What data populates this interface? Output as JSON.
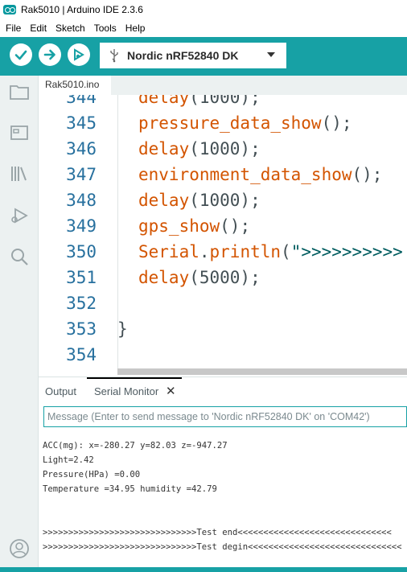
{
  "window": {
    "title": "Rak5010 | Arduino IDE 2.3.6"
  },
  "menu": [
    "File",
    "Edit",
    "Sketch",
    "Tools",
    "Help"
  ],
  "toolbar": {
    "verify_icon": "check-icon",
    "upload_icon": "arrow-right-icon",
    "debug_icon": "debug-icon",
    "board": "Nordic nRF52840 DK"
  },
  "sidebar": [
    "folder-icon",
    "boards-icon",
    "library-icon",
    "debug-icon",
    "search-icon",
    "account-icon"
  ],
  "tabs": [
    {
      "label": "Rak5010.ino"
    }
  ],
  "editor": {
    "lines": [
      {
        "n": "344",
        "code": [
          {
            "t": "delay",
            "c": "k"
          },
          {
            "t": "(1000);",
            "c": "p"
          }
        ]
      },
      {
        "n": "345",
        "code": [
          {
            "t": "pressure_data_show",
            "c": "k"
          },
          {
            "t": "();",
            "c": "p"
          }
        ]
      },
      {
        "n": "346",
        "code": [
          {
            "t": "delay",
            "c": "k"
          },
          {
            "t": "(1000);",
            "c": "p"
          }
        ]
      },
      {
        "n": "347",
        "code": [
          {
            "t": "environment_data_show",
            "c": "k"
          },
          {
            "t": "();",
            "c": "p"
          }
        ]
      },
      {
        "n": "348",
        "code": [
          {
            "t": "delay",
            "c": "k"
          },
          {
            "t": "(1000);",
            "c": "p"
          }
        ]
      },
      {
        "n": "349",
        "code": [
          {
            "t": "gps_show",
            "c": "k"
          },
          {
            "t": "();",
            "c": "p"
          }
        ]
      },
      {
        "n": "350",
        "code": [
          {
            "t": "Serial",
            "c": "k"
          },
          {
            "t": ".",
            "c": "p"
          },
          {
            "t": "println",
            "c": "k"
          },
          {
            "t": "(",
            "c": "p"
          },
          {
            "t": "\">>>>>>>>>>",
            "c": "s"
          }
        ]
      },
      {
        "n": "351",
        "code": [
          {
            "t": "delay",
            "c": "k"
          },
          {
            "t": "(5000);",
            "c": "p"
          }
        ]
      },
      {
        "n": "352",
        "code": []
      },
      {
        "n": "353",
        "code": [
          {
            "t": "}",
            "c": "p"
          }
        ]
      },
      {
        "n": "354",
        "code": []
      }
    ]
  },
  "panel": {
    "tabs": [
      "Output",
      "Serial Monitor"
    ],
    "close": "✕",
    "message_placeholder": "Message (Enter to send message to 'Nordic nRF52840 DK' on 'COM42')",
    "output": [
      "ACC(mg): x=-280.27 y=82.03 z=-947.27",
      "Light=2.42",
      "Pressure(HPa) =0.00",
      "Temperature =34.95 humidity =42.79",
      "",
      "",
      ">>>>>>>>>>>>>>>>>>>>>>>>>>>>>>Test end<<<<<<<<<<<<<<<<<<<<<<<<<<<<<<",
      ">>>>>>>>>>>>>>>>>>>>>>>>>>>>>>Test degin<<<<<<<<<<<<<<<<<<<<<<<<<<<<<<"
    ]
  },
  "colors": {
    "accent": "#17a1a5",
    "keyword": "#d35400",
    "line_number": "#27709e"
  }
}
